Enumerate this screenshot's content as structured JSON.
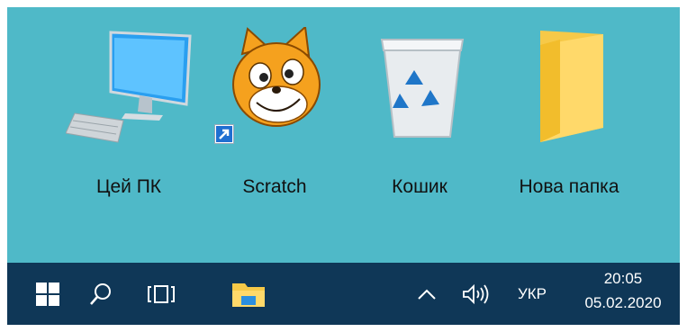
{
  "desktop": {
    "icons": [
      {
        "label": "Цей  ПК",
        "icon": "computer-monitor-icon"
      },
      {
        "label": "Scratch",
        "icon": "scratch-cat-icon"
      },
      {
        "label": "Кошик",
        "icon": "recycle-bin-icon"
      },
      {
        "label": "Нова  папка",
        "icon": "folder-icon"
      }
    ],
    "background_color": "#4fb9c8"
  },
  "taskbar": {
    "background_color": "#0f3757",
    "start_icon": "windows-start-icon",
    "search_icon": "search-icon",
    "task_view_icon": "task-view-icon",
    "explorer_icon": "file-explorer-icon",
    "tray": {
      "chevron_icon": "chevron-up-icon",
      "volume_icon": "speaker-volume-icon",
      "language": "УКР",
      "time": "20:05",
      "date": "05.02.2020"
    }
  }
}
